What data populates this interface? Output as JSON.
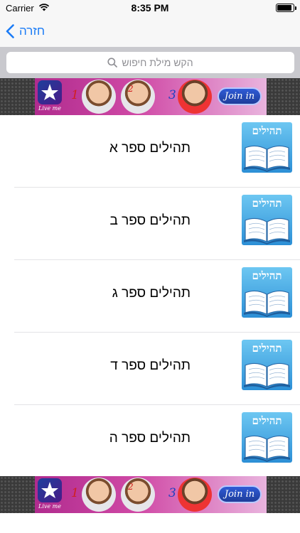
{
  "status_bar": {
    "carrier": "Carrier",
    "time": "8:35 PM",
    "battery_level": 0.9
  },
  "nav": {
    "back_label": "חזרה",
    "accent_color": "#1b7cf6"
  },
  "search": {
    "placeholder": "הקש מילת חיפוש"
  },
  "ads": {
    "top": {
      "logo_caption": "Live me",
      "ranks": [
        "1",
        "2",
        "3"
      ],
      "cta_label": "Join in"
    },
    "bottom": {
      "logo_caption": "Live me",
      "ranks": [
        "1",
        "2",
        "3"
      ],
      "cta_label": "Join in"
    }
  },
  "book_list": {
    "thumbnail_caption": "תהילים",
    "items": [
      {
        "title": "תהילים ספר א"
      },
      {
        "title": "תהילים ספר ב"
      },
      {
        "title": "תהילים ספר ג"
      },
      {
        "title": "תהילים ספר ד"
      },
      {
        "title": "תהילים ספר ה"
      }
    ]
  }
}
